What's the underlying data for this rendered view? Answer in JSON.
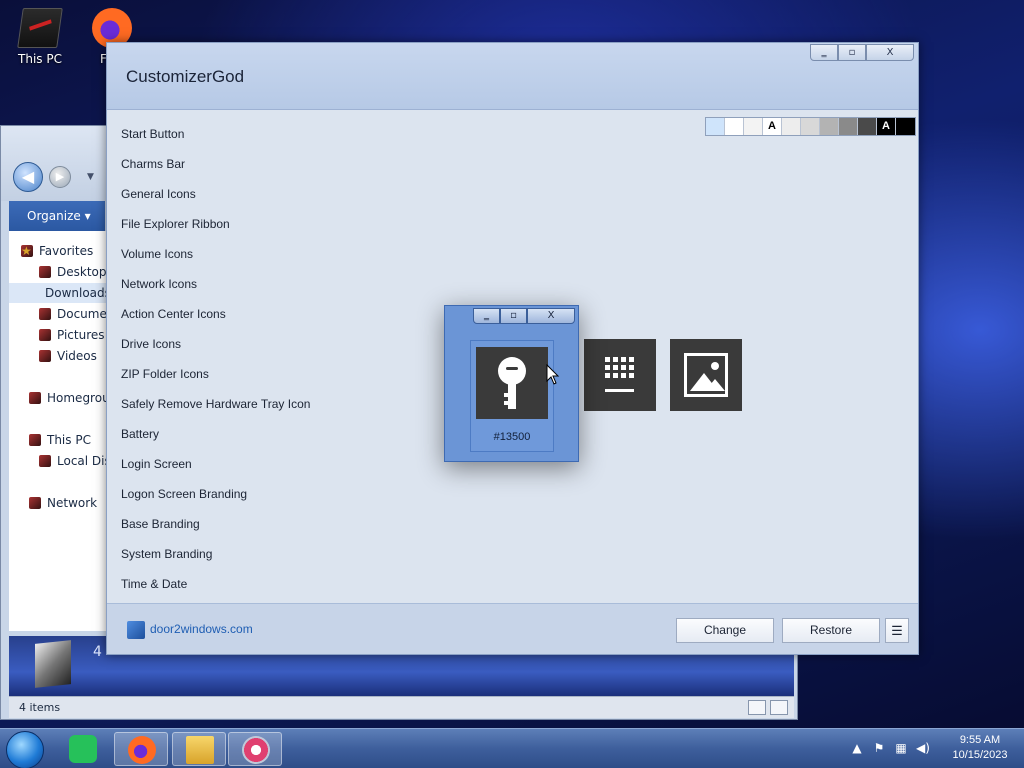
{
  "desktop": {
    "icons": [
      {
        "label": "This PC",
        "icon": "this-pc-icon"
      },
      {
        "label": "FUR",
        "icon": "firefox-icon"
      }
    ]
  },
  "explorer": {
    "toolbar": {
      "organize_label": "Organize ▾"
    },
    "nav_items": [
      {
        "label": "Favorites",
        "icon": "star-icon"
      },
      {
        "label": "Desktop",
        "icon": "desktop-icon"
      },
      {
        "label": "Downloads",
        "icon": "downloads-icon"
      },
      {
        "label": "Documents",
        "icon": "documents-icon"
      },
      {
        "label": "Pictures",
        "icon": "pictures-icon"
      },
      {
        "label": "Videos",
        "icon": "videos-icon"
      },
      {
        "label": "Homegroup",
        "icon": "homegroup-icon"
      },
      {
        "label": "This PC",
        "icon": "this-pc-icon"
      },
      {
        "label": "Local Disk",
        "icon": "local-disk-icon"
      },
      {
        "label": "Network",
        "icon": "network-icon"
      }
    ],
    "details_count": "4",
    "status_text": "4 items"
  },
  "customizer": {
    "title": "CustomizerGod",
    "caption": {
      "minimize": "‗",
      "maximize": "▫",
      "close": "X"
    },
    "menu_items": [
      "Start Button",
      "Charms Bar",
      "General Icons",
      "File Explorer Ribbon",
      "Volume Icons",
      "Network Icons",
      "Action Center Icons",
      "Drive Icons",
      "ZIP Folder Icons",
      "Safely Remove Hardware Tray Icon",
      "Battery",
      "Login Screen",
      "Logon Screen Branding",
      "Base Branding",
      "System Branding",
      "Time & Date"
    ],
    "swatches": [
      {
        "color": "#cfe4fb",
        "text": ""
      },
      {
        "color": "#ffffff",
        "text": ""
      },
      {
        "color": "#f3f3f3",
        "text": ""
      },
      {
        "color": "#ffffff",
        "text": "A"
      },
      {
        "color": "#ededed",
        "text": ""
      },
      {
        "color": "#d8d8d8",
        "text": ""
      },
      {
        "color": "#b3b3b3",
        "text": ""
      },
      {
        "color": "#8a8a8a",
        "text": ""
      },
      {
        "color": "#4a4a4a",
        "text": ""
      },
      {
        "color": "#000000",
        "text": "A"
      },
      {
        "color": "#000000",
        "text": ""
      }
    ],
    "footer": {
      "brand": "door2windows.com",
      "change_label": "Change",
      "restore_label": "Restore",
      "menu_label": "☰"
    }
  },
  "preview_window": {
    "caption": {
      "minimize": "‗",
      "maximize": "▫",
      "close": "X"
    },
    "resource_id": "#13500",
    "icon": "key-icon"
  },
  "resource_tiles": [
    {
      "icon": "keypad-grid-icon"
    },
    {
      "icon": "image-icon"
    }
  ],
  "taskbar": {
    "apps": [
      {
        "name": "Notes",
        "icon": "notes-icon"
      },
      {
        "name": "Firefox",
        "icon": "firefox-icon"
      },
      {
        "name": "File Explorer",
        "icon": "file-explorer-icon"
      },
      {
        "name": "CustomizerGod",
        "icon": "customizergod-icon",
        "active": true
      }
    ],
    "tray_icons": [
      "chevron-up-icon",
      "flag-icon",
      "network-icon",
      "volume-icon"
    ],
    "time": "9:55 AM",
    "date": "10/15/2023"
  }
}
